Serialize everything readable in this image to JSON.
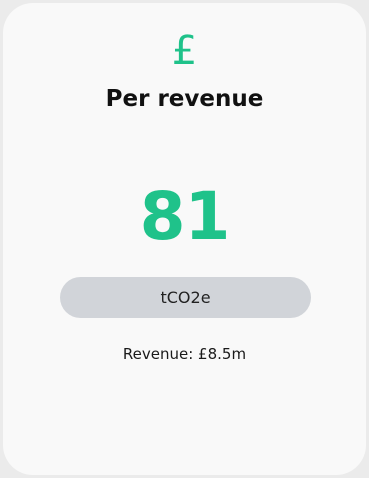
{
  "card": {
    "icon": "pound-sterling-icon",
    "icon_glyph": "£",
    "title": "Per revenue",
    "value": "81",
    "unit": "tCO2e",
    "revenue_text": "Revenue: £8.5m"
  },
  "colors": {
    "accent": "#1fc28a",
    "pill": "#d1d4d9",
    "card_background": "#f9f9f9"
  }
}
